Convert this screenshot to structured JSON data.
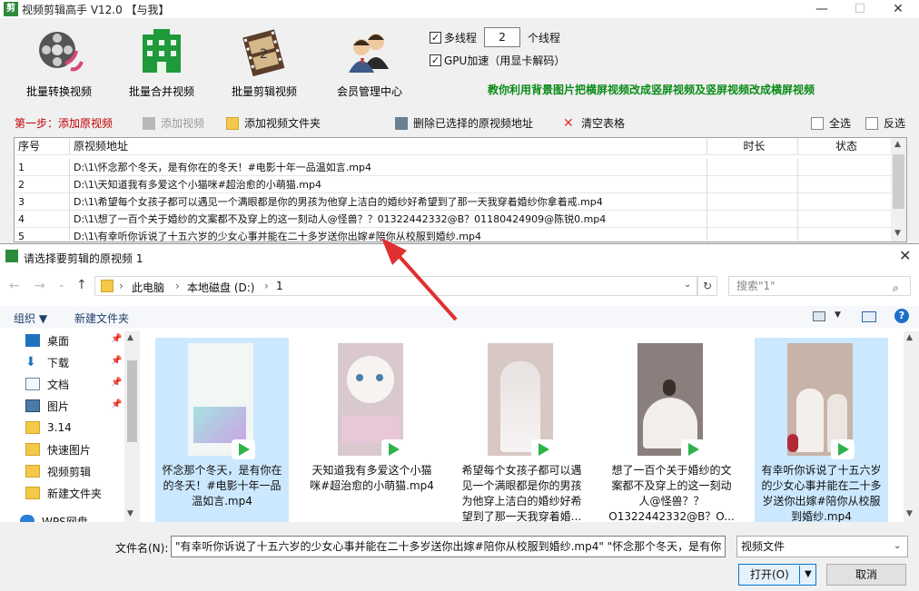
{
  "app": {
    "title": "视频剪辑高手 V12.0   【与我】",
    "tools": [
      {
        "label": "批量转换视频",
        "icon": "film-reel-icon"
      },
      {
        "label": "批量合并视频",
        "icon": "building-icon"
      },
      {
        "label": "批量剪辑视频",
        "icon": "film-strip-icon"
      },
      {
        "label": "会员管理中心",
        "icon": "users-icon"
      }
    ],
    "options": {
      "multithread_label": "多线程",
      "multithread_checked": true,
      "thread_count": "2",
      "thread_unit": "个线程",
      "gpu_label": "GPU加速（用显卡解码）",
      "gpu_checked": true
    },
    "tip": "教你利用背景图片把横屏视频改成竖屏视频及竖屏视频改成横屏视频",
    "step": {
      "label": "第一步：添加原视频",
      "add_video": "添加视频",
      "add_folder": "添加视频文件夹",
      "delete_selected": "删除已选择的原视频地址",
      "clear_table": "清空表格",
      "select_all": "全选",
      "invert": "反选"
    },
    "table": {
      "headers": [
        "序号",
        "原视频地址",
        "时长",
        "状态"
      ],
      "rows": [
        {
          "no": "1",
          "path": "D:\\1\\怀念那个冬天，是有你在的冬天！#电影十年一品温如言.mp4",
          "duration": "",
          "status": ""
        },
        {
          "no": "2",
          "path": "D:\\1\\天知道我有多爱这个小猫咪#超治愈的小萌猫.mp4",
          "duration": "",
          "status": ""
        },
        {
          "no": "3",
          "path": "D:\\1\\希望每个女孩子都可以遇见一个满眼都是你的男孩为他穿上洁白的婚纱好希望到了那一天我穿着婚纱你拿着戒.mp4",
          "duration": "",
          "status": ""
        },
        {
          "no": "4",
          "path": "D:\\1\\想了一百个关于婚纱的文案都不及穿上的这一刻动人@怪兽？？01322442332@B？01180424909@陈锐0.mp4",
          "duration": "",
          "status": ""
        },
        {
          "no": "5",
          "path": "D:\\1\\有幸听你诉说了十五六岁的少女心事并能在二十多岁送你出嫁#陪你从校服到婚纱.mp4",
          "duration": "",
          "status": ""
        }
      ]
    }
  },
  "dialog": {
    "title": "请选择要剪辑的原视频 1",
    "breadcrumb": [
      "此电脑",
      "本地磁盘 (D:)",
      "1"
    ],
    "search_placeholder": "搜索\"1\"",
    "organize": "组织 ▼",
    "new_folder": "新建文件夹",
    "nav_items": [
      {
        "label": "桌面",
        "icon": "desktop-icon",
        "pinned": true
      },
      {
        "label": "下载",
        "icon": "download-icon",
        "pinned": true
      },
      {
        "label": "文档",
        "icon": "document-icon",
        "pinned": true
      },
      {
        "label": "图片",
        "icon": "picture-icon",
        "pinned": true
      },
      {
        "label": "3.14",
        "icon": "folder-icon",
        "pinned": false
      },
      {
        "label": "快速图片",
        "icon": "folder-icon",
        "pinned": false
      },
      {
        "label": "视频剪辑",
        "icon": "folder-icon",
        "pinned": false
      },
      {
        "label": "新建文件夹",
        "icon": "folder-icon",
        "pinned": false
      },
      {
        "label": "WPS网盘",
        "icon": "cloud-icon",
        "pinned": false
      }
    ],
    "files": [
      {
        "name": "怀念那个冬天，是有你在的冬天！#电影十年一品温如言.mp4",
        "selected": true,
        "thumb": "#f2f6f4"
      },
      {
        "name": "天知道我有多爱这个小猫咪#超治愈的小萌猫.mp4",
        "selected": false,
        "thumb": "#d9c9cf"
      },
      {
        "name": "希望每个女孩子都可以遇见一个满眼都是你的男孩为他穿上洁白的婚纱好希望到了那一天我穿着婚...",
        "selected": false,
        "thumb": "#d8c8c4"
      },
      {
        "name": "想了一百个关于婚纱的文案都不及穿上的这一刻动人@怪兽？？O1322442332@B？O...",
        "selected": false,
        "thumb": "#8a7f7c"
      },
      {
        "name": "有幸听你诉说了十五六岁的少女心事并能在二十多岁送你出嫁#陪你从校服到婚纱.mp4",
        "selected": true,
        "thumb": "#c8b3a8"
      }
    ],
    "filename_label": "文件名(N):",
    "filename_value": "\"有幸听你诉说了十五六岁的少女心事并能在二十多岁送你出嫁#陪你从校服到婚纱.mp4\" \"怀念那个冬天，是有你",
    "filetype": "视频文件",
    "open_button": "打开(O)",
    "cancel_button": "取消"
  },
  "colors": {
    "accent_green": "#0a8a18",
    "step_red": "#c00000",
    "selection": "#cce8ff",
    "arrow": "#e03030"
  }
}
